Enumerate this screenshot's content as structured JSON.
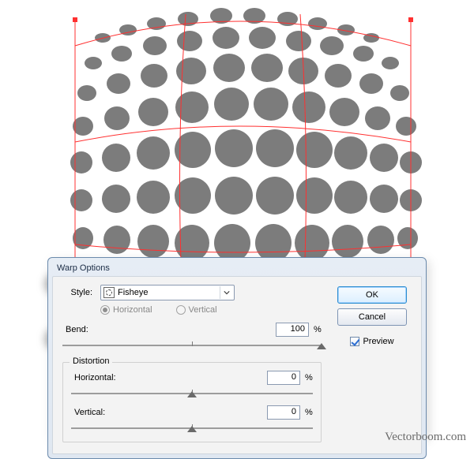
{
  "dialog": {
    "title": "Warp Options",
    "style_label": "Style:",
    "style_value": "Fisheye",
    "orientation": {
      "horizontal_label": "Horizontal",
      "vertical_label": "Vertical",
      "selected": "horizontal"
    },
    "bend": {
      "label": "Bend:",
      "value": "100",
      "unit": "%"
    },
    "distortion": {
      "group_label": "Distortion",
      "horizontal_label": "Horizontal:",
      "horizontal_value": "0",
      "vertical_label": "Vertical:",
      "vertical_value": "0",
      "unit": "%"
    },
    "ok_label": "OK",
    "cancel_label": "Cancel",
    "preview_label": "Preview",
    "preview_checked": true
  },
  "watermark": "Vectorboom.com",
  "dot_color": "#7c7c7c",
  "grid_color": "#ff3030"
}
